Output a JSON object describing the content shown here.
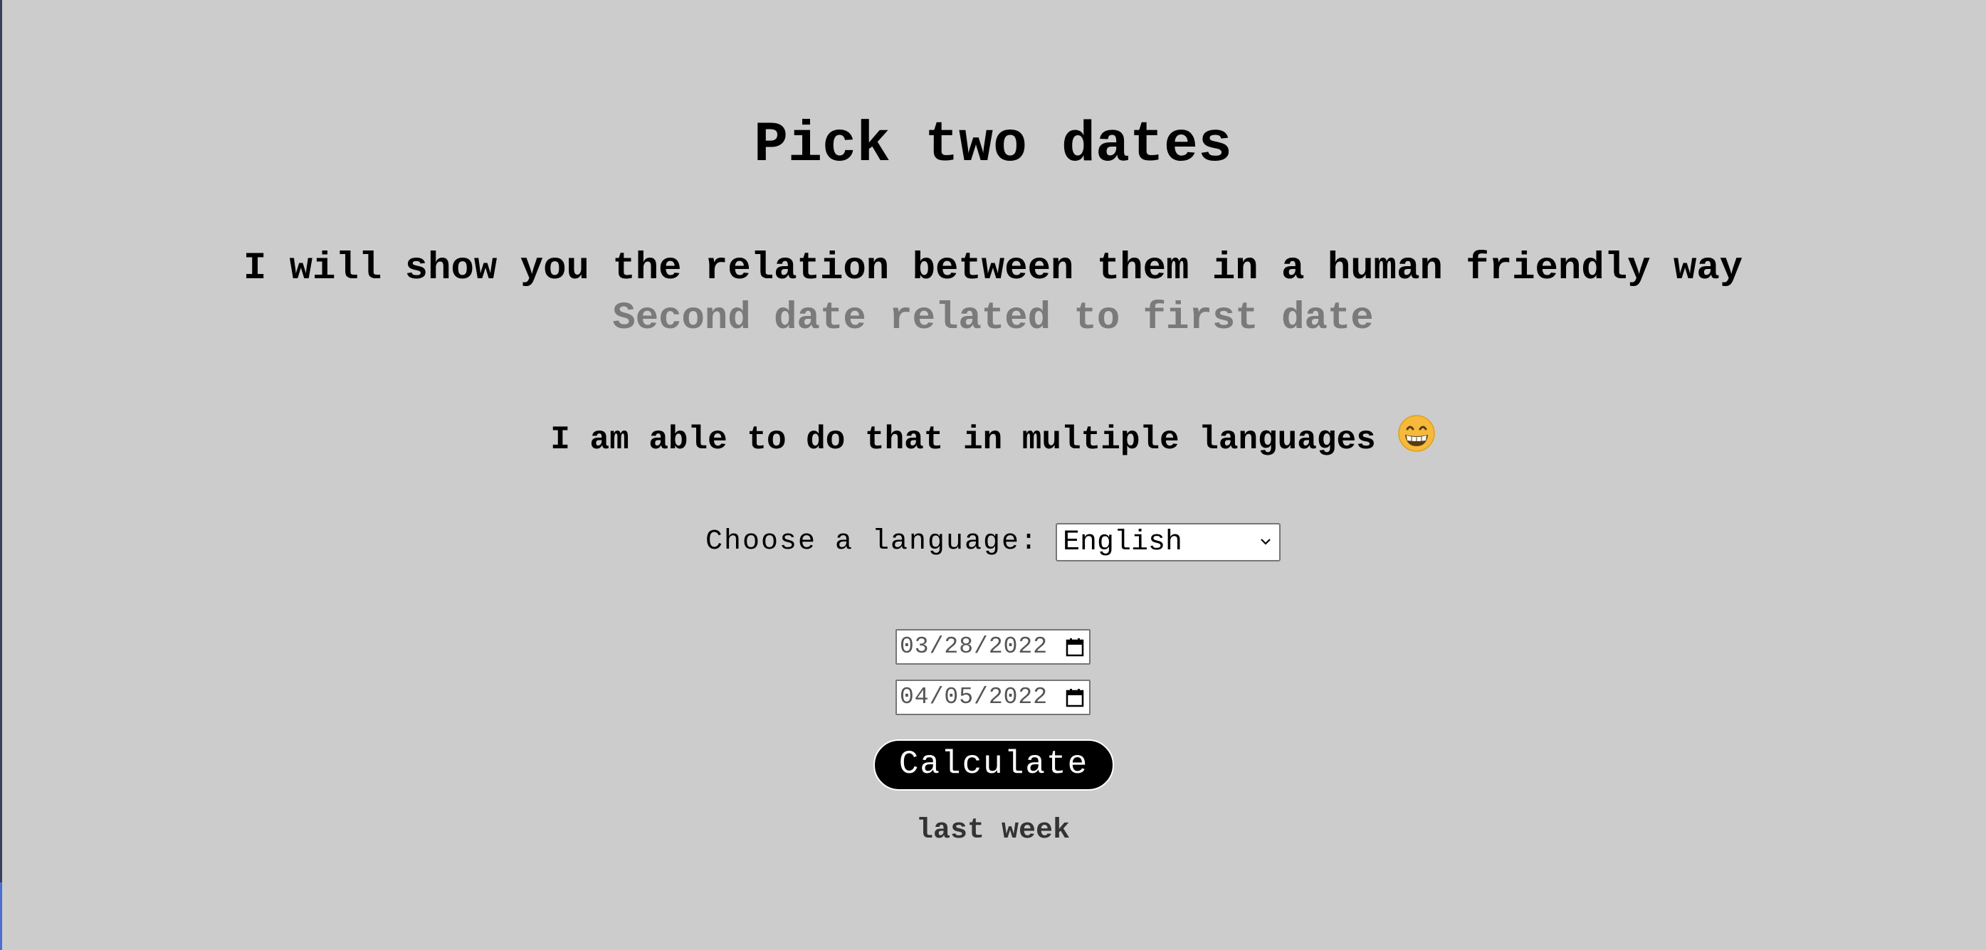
{
  "page": {
    "title": "Pick two dates",
    "subtitle": "I will show you the relation between them in a human friendly way",
    "hint": "Second date related to first date",
    "multi_language_text": "I am able to do that in multiple languages",
    "emoji_icon": "grinning-face-with-smiling-eyes"
  },
  "language": {
    "label": "Choose a language:",
    "selected": "English"
  },
  "dates": {
    "first": "03/28/2022",
    "second": "04/05/2022"
  },
  "actions": {
    "calculate_label": "Calculate"
  },
  "result": {
    "text": "last week"
  },
  "colors": {
    "background": "#cccccc",
    "hint": "#7a7a7a",
    "button_bg": "#000000",
    "button_text": "#ffffff"
  }
}
